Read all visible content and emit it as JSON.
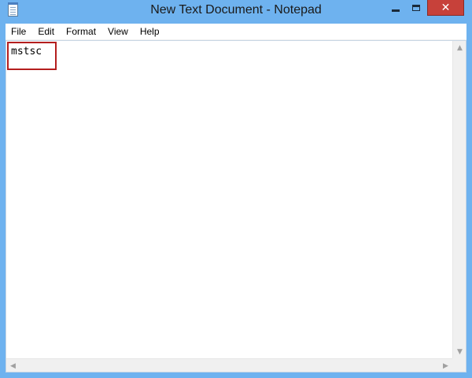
{
  "window": {
    "title": "New Text Document - Notepad"
  },
  "title_buttons": {
    "close_glyph": "✕"
  },
  "menu": {
    "items": [
      {
        "label": "File"
      },
      {
        "label": "Edit"
      },
      {
        "label": "Format"
      },
      {
        "label": "View"
      },
      {
        "label": "Help"
      }
    ]
  },
  "document": {
    "text": "mstsc"
  },
  "scroll": {
    "up": "▲",
    "down": "▼",
    "left": "◀",
    "right": "▶"
  },
  "colors": {
    "titlebar": "#6eb2ef",
    "close_button": "#c7413a",
    "highlight_box": "#b41e1e"
  },
  "icons": {
    "app": "notepad-icon",
    "minimize": "minimize-icon",
    "maximize": "maximize-icon",
    "close": "close-icon"
  }
}
